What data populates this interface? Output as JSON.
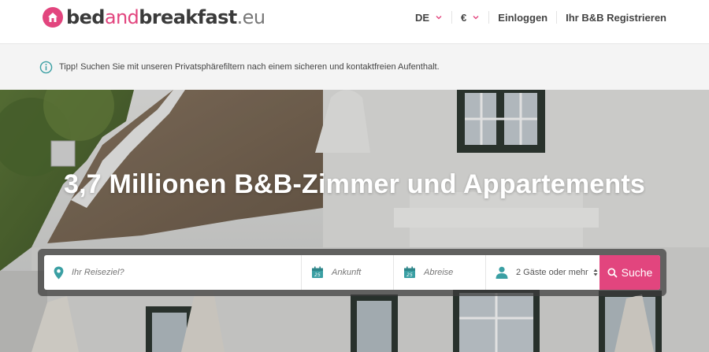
{
  "header": {
    "logo": {
      "part1": "bed",
      "part2": "and",
      "part3": "breakfast",
      "part4": ".eu"
    },
    "nav": {
      "language": "DE",
      "currency": "€",
      "login": "Einloggen",
      "register": "Ihr B&B Registrieren"
    }
  },
  "tip": {
    "text": "Tipp! Suchen Sie mit unseren Privatsphärefiltern nach einem sicheren und kontaktfreien Aufenthalt."
  },
  "hero": {
    "title": "3,7 Millionen B&B-Zimmer und Appartements"
  },
  "search": {
    "destination_placeholder": "Ihr Reiseziel?",
    "arrival_label": "Ankunft",
    "departure_label": "Abreise",
    "guests_value": "2 Gäste oder mehr",
    "submit_label": "Suche",
    "calendar_day": "25"
  },
  "colors": {
    "accent": "#e2457e",
    "teal": "#3a9fa3"
  },
  "icons": {
    "tip": "info-icon",
    "destination": "location-pin-icon",
    "arrival": "calendar-icon",
    "departure": "calendar-icon",
    "guests": "person-icon",
    "submit": "search-icon"
  }
}
